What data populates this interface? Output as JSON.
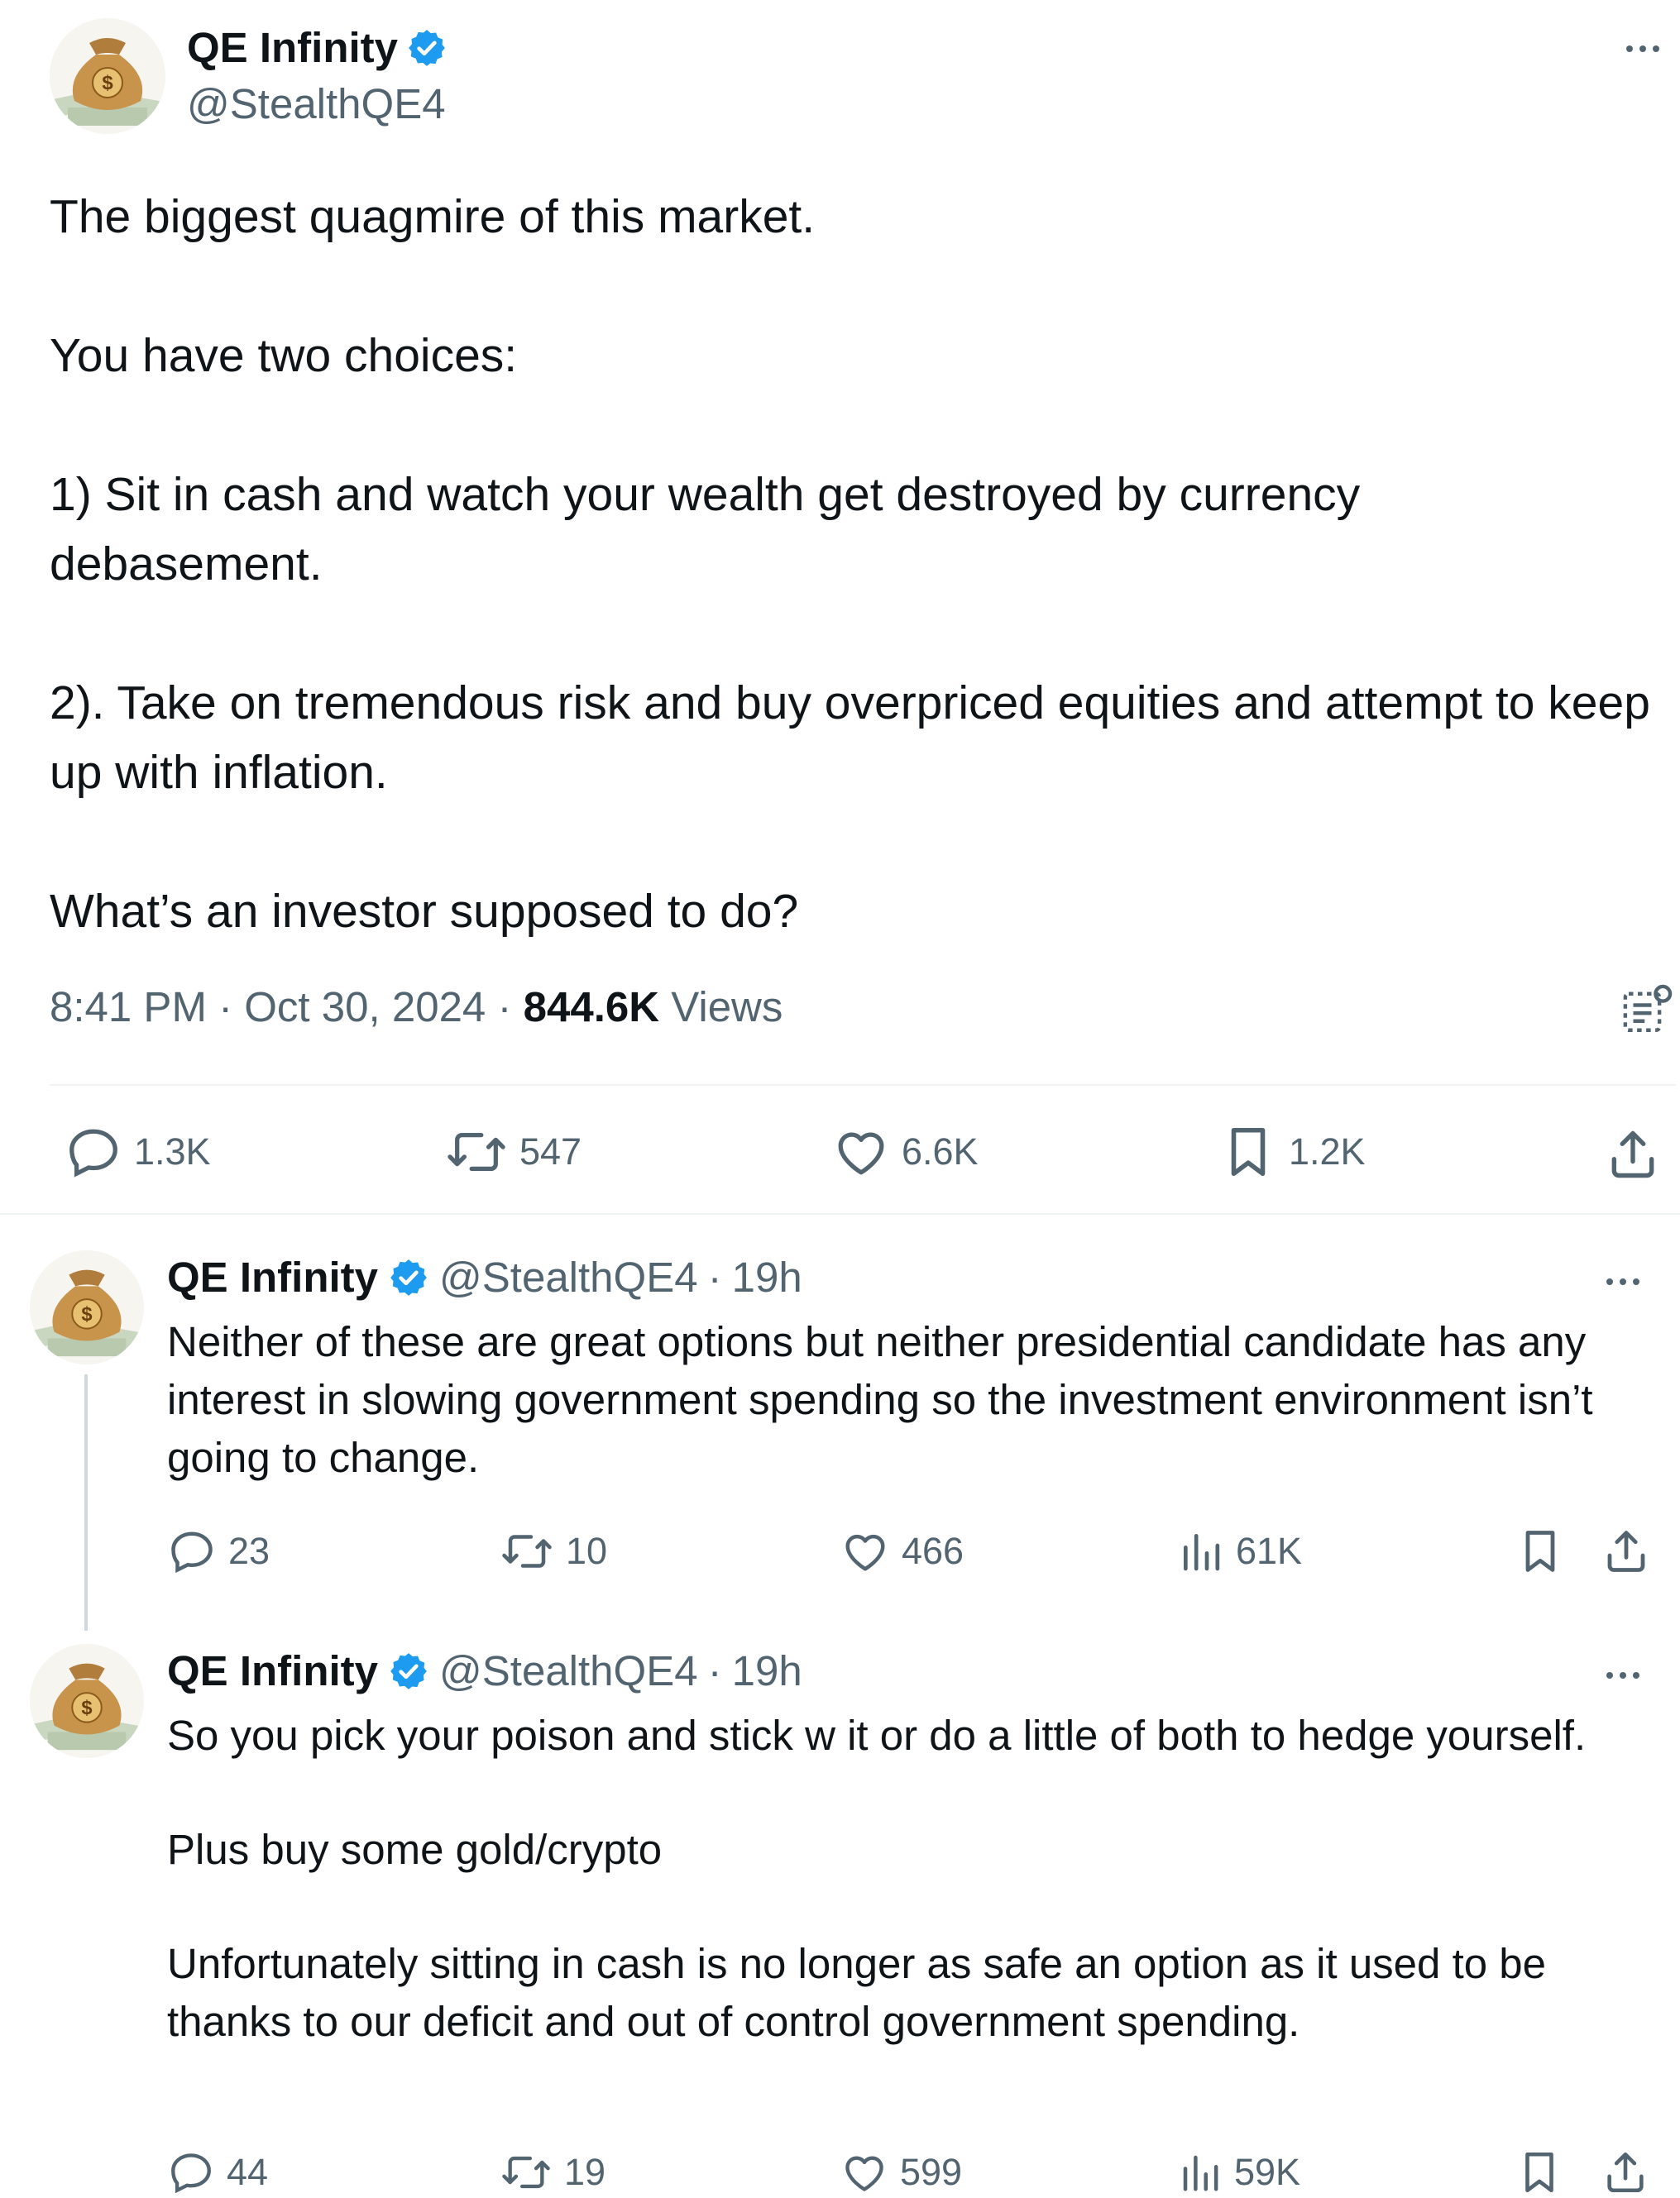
{
  "main_tweet": {
    "author": "QE Infinity",
    "handle": "@StealthQE4",
    "paragraphs": [
      "The biggest quagmire of this market.",
      "You have two choices:",
      "1) Sit in cash and watch your wealth get destroyed by currency debasement.",
      "2). Take on tremendous risk and buy overpriced equities and attempt to keep up with inflation.",
      "What’s an investor supposed to do?"
    ],
    "time": "8:41 PM",
    "date": "Oct 30, 2024",
    "separator": "·",
    "views_count": "844.6K",
    "views_label": "Views",
    "stats": {
      "replies": "1.3K",
      "reposts": "547",
      "likes": "6.6K",
      "bookmarks": "1.2K"
    }
  },
  "replies": [
    {
      "author": "QE Infinity",
      "handle": "@StealthQE4",
      "separator": "·",
      "age": "19h",
      "paragraphs": [
        "Neither of these are great options but neither presidential candidate has any interest in slowing government spending so the investment environment isn’t going to change."
      ],
      "stats": {
        "replies": "23",
        "reposts": "10",
        "likes": "466",
        "views": "61K"
      }
    },
    {
      "author": "QE Infinity",
      "handle": "@StealthQE4",
      "separator": "·",
      "age": "19h",
      "paragraphs": [
        "So you pick your poison and stick w it or do a little of both to hedge yourself.",
        "Plus buy some gold/crypto",
        "Unfortunately sitting in cash is no longer as safe an option as it used to be thanks to our deficit and out of control government spending."
      ],
      "stats": {
        "replies": "44",
        "reposts": "19",
        "likes": "599",
        "views": "59K"
      }
    }
  ],
  "colors": {
    "text": "#0f1419",
    "secondary": "#536471",
    "verified": "#1d9bf0",
    "divider": "#eff3f4",
    "thread_line": "#cfd9de"
  },
  "icons": [
    "money-bag-avatar",
    "verified-badge-icon",
    "more-icon",
    "reply-icon",
    "repost-icon",
    "like-icon",
    "bookmark-icon",
    "views-icon",
    "share-icon",
    "analytics-icon"
  ]
}
